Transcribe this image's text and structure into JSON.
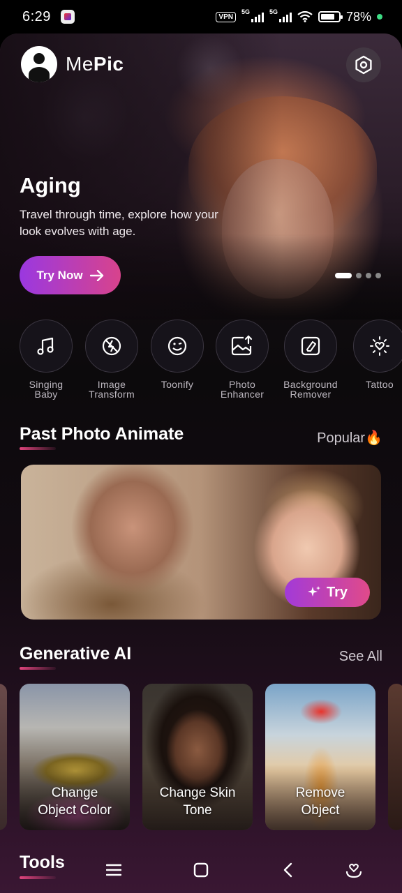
{
  "status_bar": {
    "time": "6:29",
    "vpn": "VPN",
    "network1": "5G",
    "network2": "5G",
    "battery_percent": "78%"
  },
  "header": {
    "brand_prefix": "Me",
    "brand_suffix": "Pic",
    "settings_icon": "settings-hexagon-icon"
  },
  "hero": {
    "title": "Aging",
    "description": "Travel through time, explore how your look evolves with age.",
    "button_label": "Try Now",
    "slides": 4,
    "active_slide": 1
  },
  "tools": [
    {
      "label": "Singing\nBaby",
      "icon": "music-note-icon"
    },
    {
      "label": "Image\nTransform",
      "icon": "transform-icon"
    },
    {
      "label": "Toonify",
      "icon": "smiley-icon"
    },
    {
      "label": "Photo\nEnhancer",
      "icon": "photo-upload-icon"
    },
    {
      "label": "Background\nRemover",
      "icon": "eraser-icon"
    },
    {
      "label": "Tattoo",
      "icon": "sun-heart-icon"
    }
  ],
  "past_photo": {
    "title": "Past Photo Animate",
    "tag": "Popular🔥",
    "try_label": "Try"
  },
  "generative": {
    "title": "Generative AI",
    "see_all": "See All",
    "cards": [
      {
        "label": "Change\nObject Color"
      },
      {
        "label": "Change Skin\nTone"
      },
      {
        "label": "Remove\nObject"
      }
    ]
  },
  "bottom": {
    "tools_title": "Tools"
  },
  "colors": {
    "accent_purple": "#9a38e0",
    "accent_pink": "#d8438c"
  }
}
